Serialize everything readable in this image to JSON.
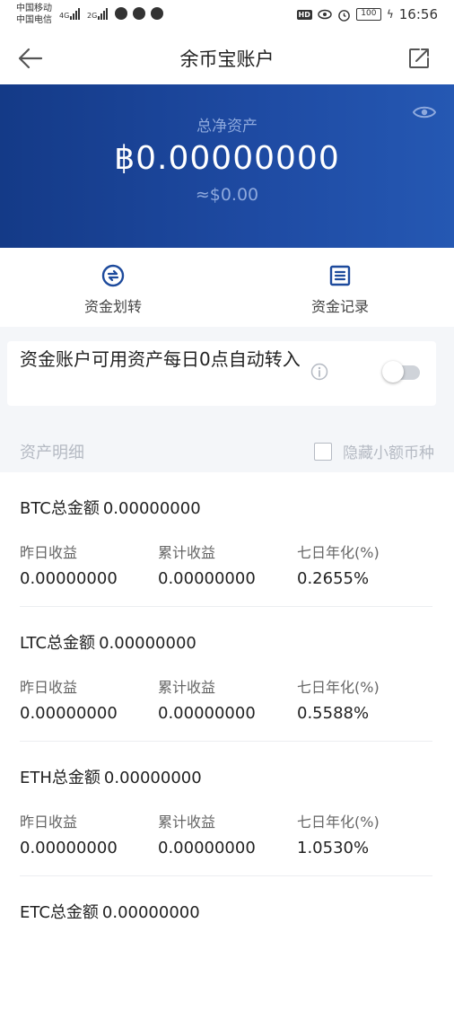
{
  "status_bar": {
    "carrier_1": "中国移动",
    "carrier_2": "中国电信",
    "net_1": "4G",
    "net_2": "2G",
    "hd": "HD",
    "battery": "100",
    "time": "16:56"
  },
  "nav": {
    "title": "余币宝账户"
  },
  "hero": {
    "label": "总净资产",
    "value": "฿0.00000000",
    "fiat": "≈$0.00"
  },
  "actions": [
    {
      "label": "资金划转",
      "icon": "transfer-icon"
    },
    {
      "label": "资金记录",
      "icon": "records-icon"
    }
  ],
  "auto_transfer": {
    "text": "资金账户可用资产每日0点自动转入",
    "enabled": false
  },
  "detail": {
    "label": "资产明细",
    "hide_small_label": "隐藏小额币种"
  },
  "assets": [
    {
      "total_label": "BTC总金额",
      "total_value": "0.00000000",
      "yesterday_label": "昨日收益",
      "yesterday_value": "0.00000000",
      "cumulative_label": "累计收益",
      "cumulative_value": "0.00000000",
      "annual_label": "七日年化(%)",
      "annual_value": "0.2655%"
    },
    {
      "total_label": "LTC总金额",
      "total_value": "0.00000000",
      "yesterday_label": "昨日收益",
      "yesterday_value": "0.00000000",
      "cumulative_label": "累计收益",
      "cumulative_value": "0.00000000",
      "annual_label": "七日年化(%)",
      "annual_value": "0.5588%"
    },
    {
      "total_label": "ETH总金额",
      "total_value": "0.00000000",
      "yesterday_label": "昨日收益",
      "yesterday_value": "0.00000000",
      "cumulative_label": "累计收益",
      "cumulative_value": "0.00000000",
      "annual_label": "七日年化(%)",
      "annual_value": "1.0530%"
    },
    {
      "total_label": "ETC总金额",
      "total_value": "0.00000000"
    }
  ],
  "colors": {
    "hero_start": "#143a87",
    "hero_end": "#2558b3",
    "accent": "#1d4a9c",
    "muted": "#b5bac3"
  }
}
